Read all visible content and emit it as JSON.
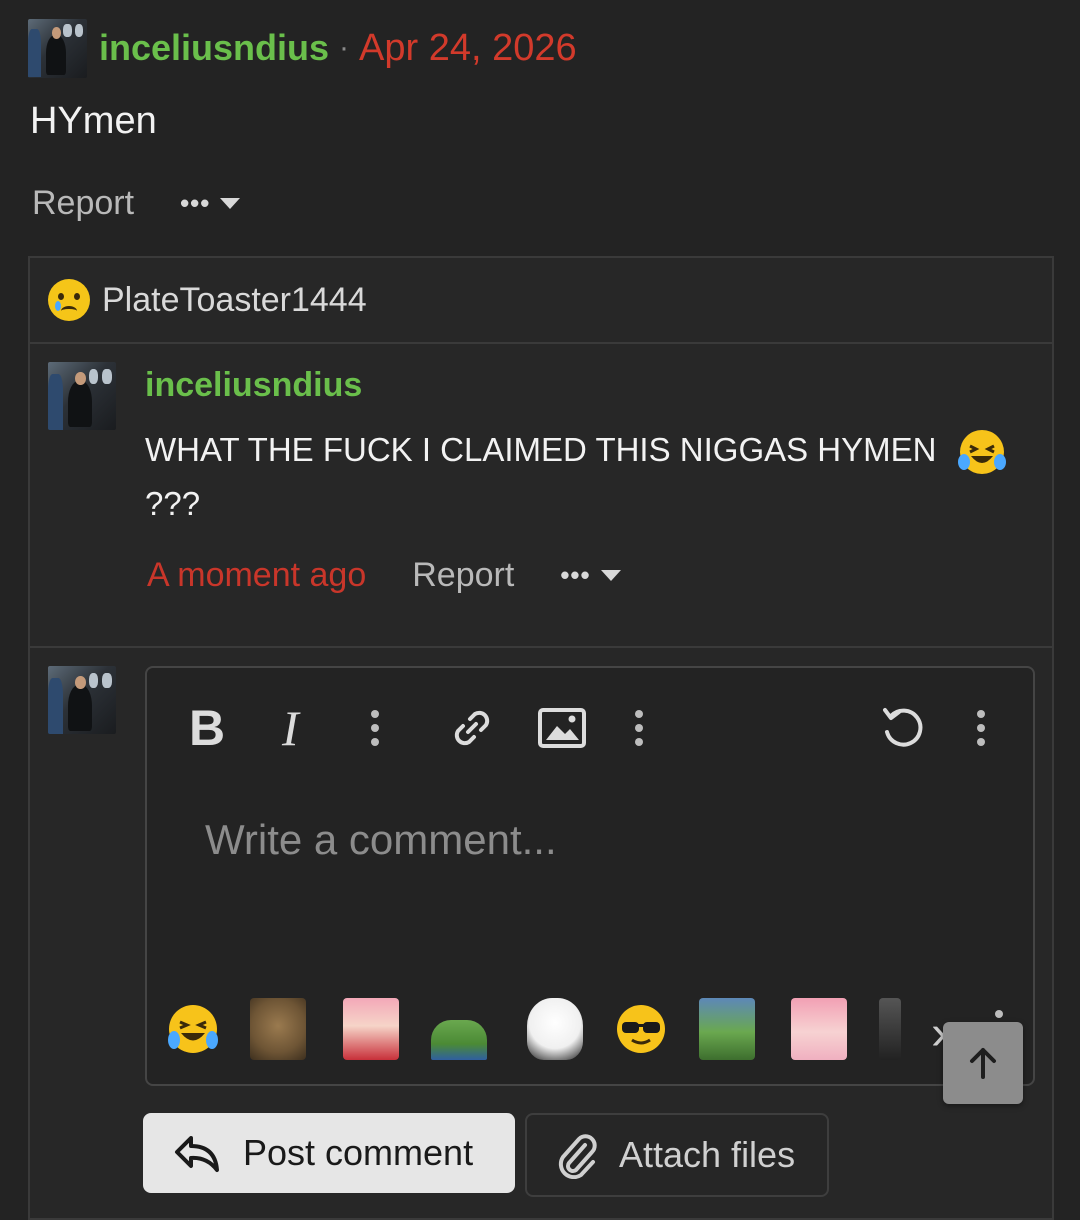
{
  "post": {
    "username": "inceliusndius",
    "separator": "·",
    "date": "Apr 24, 2026",
    "body": "HYmen",
    "report_label": "Report",
    "more_dots": "•••"
  },
  "reactions": {
    "emoji": "crying-face-icon",
    "user": "PlateToaster1444"
  },
  "comment": {
    "username": "inceliusndius",
    "text": "WHAT THE FUCK I CLAIMED THIS NIGGAS HYMEN",
    "text_line2": "???",
    "inline_emoji": "laughing-crying-icon",
    "time": "A moment ago",
    "report_label": "Report",
    "more_dots": "•••"
  },
  "editor": {
    "bold_label": "B",
    "italic_label": "I",
    "placeholder": "Write a comment..."
  },
  "emoji_tray": [
    "laughing-crying-icon",
    "capybara-sticker",
    "anime-girl-sticker",
    "pepe-sticker",
    "wojak-sticker",
    "sunglasses-emoji",
    "pepe-rain-sticker",
    "anime-girl-blush-sticker",
    "partial-sticker"
  ],
  "buttons": {
    "post_comment": "Post comment",
    "attach_files": "Attach files"
  },
  "colors": {
    "username": "#6abf4b",
    "date": "#d23a2b",
    "background": "#232323"
  }
}
